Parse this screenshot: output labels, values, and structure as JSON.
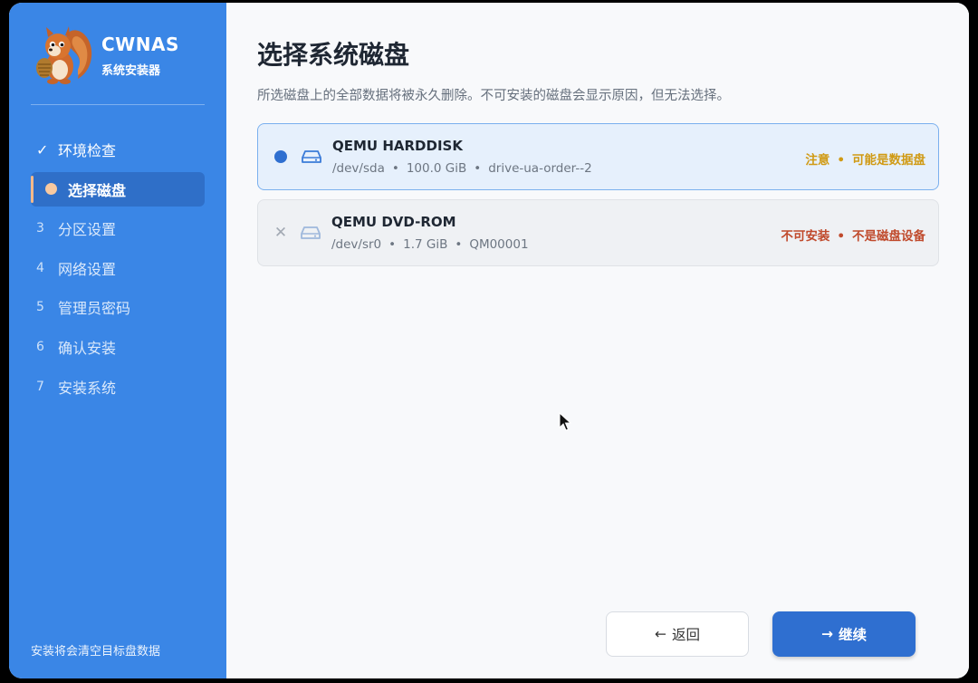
{
  "app": {
    "name": "CWNAS",
    "subtitle": "系统安装器"
  },
  "sidebar": {
    "steps": [
      {
        "num": "✓",
        "label": "环境检查",
        "state": "done"
      },
      {
        "num": "",
        "label": "选择磁盘",
        "state": "active"
      },
      {
        "num": "3",
        "label": "分区设置",
        "state": "pending"
      },
      {
        "num": "4",
        "label": "网络设置",
        "state": "pending"
      },
      {
        "num": "5",
        "label": "管理员密码",
        "state": "pending"
      },
      {
        "num": "6",
        "label": "确认安装",
        "state": "pending"
      },
      {
        "num": "7",
        "label": "安装系统",
        "state": "pending"
      }
    ],
    "footer_note": "安装将会清空目标盘数据"
  },
  "main": {
    "title": "选择系统磁盘",
    "subtitle": "所选磁盘上的全部数据将被永久删除。不可安装的磁盘会显示原因，但无法选择。",
    "disks": [
      {
        "name": "QEMU HARDDISK",
        "path": "/dev/sda",
        "size": "100.0 GiB",
        "serial": "drive-ua-order--2",
        "status": "注意",
        "reason": "可能是数据盘",
        "selected": true,
        "installable": true
      },
      {
        "name": "QEMU DVD-ROM",
        "path": "/dev/sr0",
        "size": "1.7 GiB",
        "serial": "QM00001",
        "status": "不可安装",
        "reason": "不是磁盘设备",
        "selected": false,
        "installable": false
      }
    ],
    "buttons": {
      "back": "返回",
      "next": "继续"
    }
  },
  "colors": {
    "sidebar_bg": "#3a86e6",
    "primary": "#2f6fd0",
    "warning": "#d09a14",
    "error": "#c04a2c"
  },
  "icons": {
    "selected_marker": "radio-dot-icon",
    "disabled_marker": "x-icon",
    "drive": "hard-drive-icon",
    "back": "arrow-left-icon",
    "next": "arrow-right-icon"
  }
}
